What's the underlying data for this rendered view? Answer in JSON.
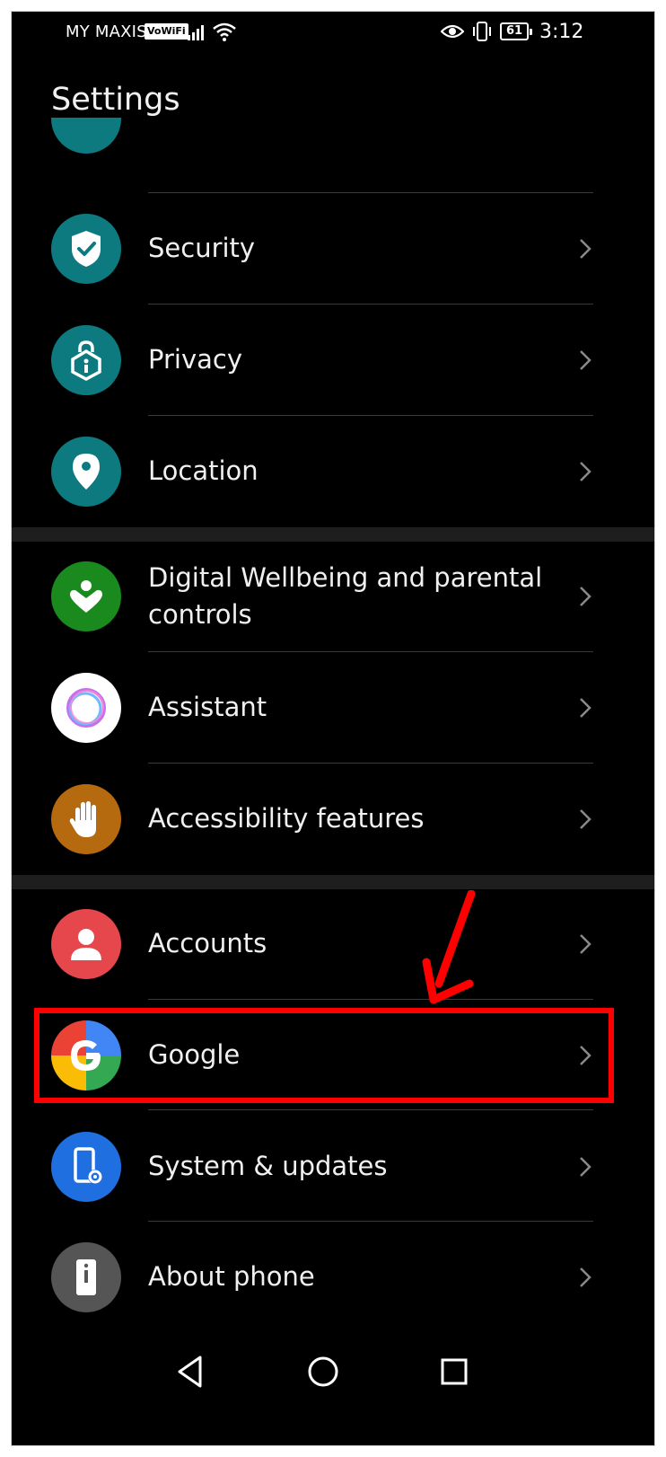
{
  "status_bar": {
    "carrier": "MY MAXIS",
    "vowifi": "VoWiFi",
    "battery": "61",
    "time": "3:12"
  },
  "page_title": "Settings",
  "items": [
    {
      "label": "Security",
      "icon": "shield-check-icon",
      "color": "#0d7a80"
    },
    {
      "label": "Privacy",
      "icon": "privacy-lock-icon",
      "color": "#0d7a80"
    },
    {
      "label": "Location",
      "icon": "location-pin-icon",
      "color": "#0d7a80"
    },
    {
      "label": "Digital Wellbeing and parental controls",
      "icon": "wellbeing-icon",
      "color": "#1a8a1e"
    },
    {
      "label": "Assistant",
      "icon": "assistant-icon",
      "color": "#ffffff"
    },
    {
      "label": "Accessibility features",
      "icon": "hand-icon",
      "color": "#b56a10"
    },
    {
      "label": "Accounts",
      "icon": "person-icon",
      "color": "#e6474d"
    },
    {
      "label": "Google",
      "icon": "google-icon",
      "color": "#4285f4"
    },
    {
      "label": "System & updates",
      "icon": "phone-gear-icon",
      "color": "#1f6fe0"
    },
    {
      "label": "About phone",
      "icon": "phone-info-icon",
      "color": "#555555"
    }
  ],
  "colors": {
    "background": "#000000",
    "text": "#f0f0f0",
    "highlight": "#ff0000"
  },
  "navigation": {
    "back": "back-icon",
    "home": "home-icon",
    "recents": "recents-icon"
  }
}
